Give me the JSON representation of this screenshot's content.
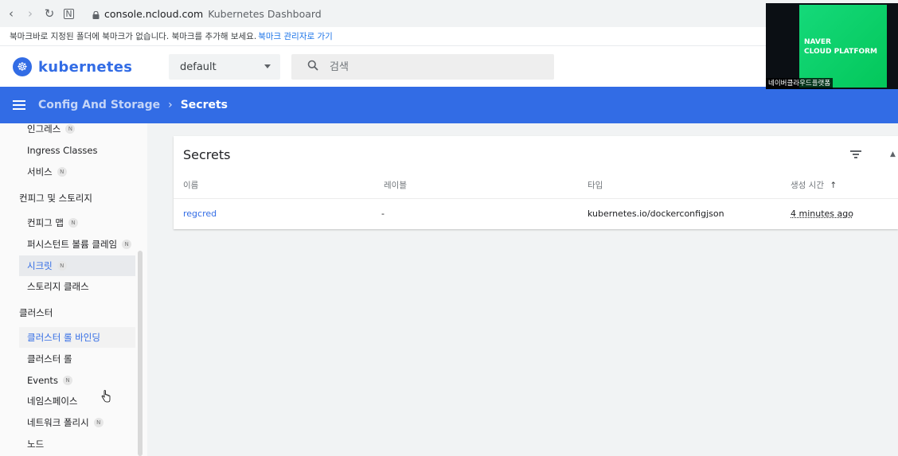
{
  "browser": {
    "url_domain": "console.ncloud.com",
    "tab_title": "Kubernetes Dashboard",
    "bookmark_text": "북마크바로 지정된 폴더에 북마크가 없습니다. 북마크를 추가해 보세요.",
    "bookmark_link": "북마크 관리자로 가기"
  },
  "header": {
    "logo_text": "kubernetes",
    "namespace_value": "default",
    "search_placeholder": "검색"
  },
  "toolbar": {
    "breadcrumb_parent": "Config And Storage",
    "breadcrumb_current": "Secrets"
  },
  "sidebar": {
    "items": [
      {
        "label": "인그레스",
        "badge": "N"
      },
      {
        "label": "Ingress Classes",
        "badge": ""
      },
      {
        "label": "서비스",
        "badge": "N"
      },
      {
        "label": "컨피그 및 스토리지",
        "badge": "",
        "section": true
      },
      {
        "label": "컨피그 맵",
        "badge": "N"
      },
      {
        "label": "퍼시스턴트 볼륨 클레임",
        "badge": "N"
      },
      {
        "label": "시크릿",
        "badge": "N",
        "active": true
      },
      {
        "label": "스토리지 클래스",
        "badge": ""
      },
      {
        "label": "클러스터",
        "badge": "",
        "section": true
      },
      {
        "label": "클러스터 롤 바인딩",
        "badge": ""
      },
      {
        "label": "클러스터 롤",
        "badge": ""
      },
      {
        "label": "Events",
        "badge": "N"
      },
      {
        "label": "네임스페이스",
        "badge": ""
      },
      {
        "label": "네트워크 폴리시",
        "badge": "N"
      },
      {
        "label": "노드",
        "badge": ""
      }
    ]
  },
  "secrets_card": {
    "title": "Secrets",
    "columns": [
      "이름",
      "레이블",
      "타입",
      "생성 시간"
    ],
    "sort_indicator": "↑",
    "rows": [
      {
        "name": "regcred",
        "labels": "-",
        "type": "kubernetes.io/dockerconfigjson",
        "created": "4 minutes ago"
      }
    ]
  },
  "video_overlay": {
    "logo_line1": "NAVER",
    "logo_line2": "CLOUD PLATFORM",
    "caption": "네이버클라우드플랫폼"
  },
  "colors": {
    "brand_blue": "#326ce5",
    "naver_green": "#03c75a"
  }
}
